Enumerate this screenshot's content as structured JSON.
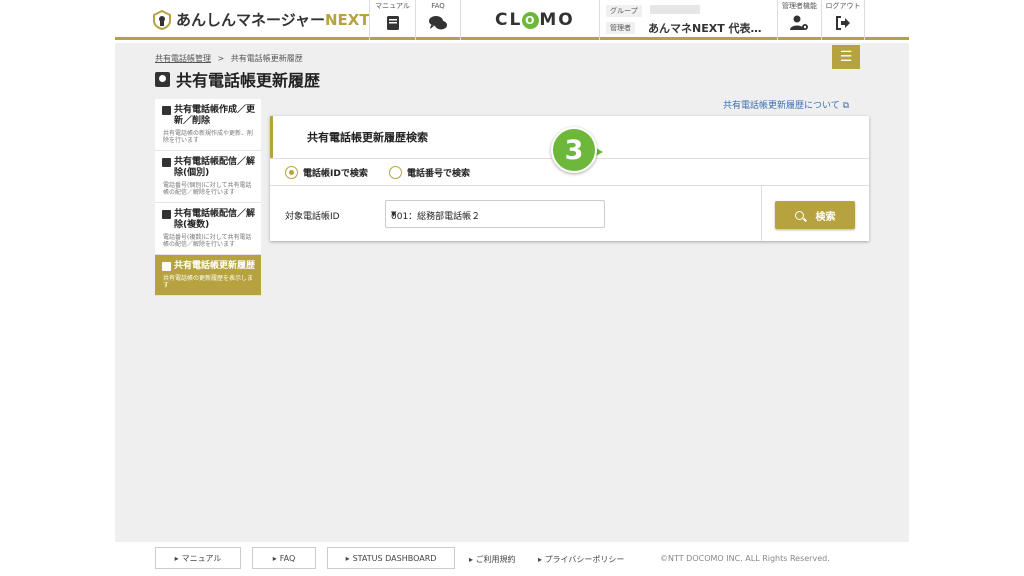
{
  "header": {
    "logo_text": "あんしんマネージャー",
    "logo_accent": "NEXT",
    "manual_caption": "マニュアル",
    "faq_caption": "FAQ",
    "clomo_left": "CL",
    "clomo_o": "O",
    "clomo_right": "MO",
    "group_label": "グループ",
    "admin_label": "管理者",
    "admin_name": "あんマネNEXT 代表…",
    "admin_func_caption": "管理者機能",
    "logout_caption": "ログアウト"
  },
  "breadcrumb": {
    "parent": "共有電話帳管理",
    "separator": ">",
    "current": "共有電話帳更新履歴"
  },
  "page_title": "共有電話帳更新履歴",
  "help_link": "共有電話帳更新履歴について",
  "sidebar": {
    "items": [
      {
        "title": "共有電話帳作成／更新／削除",
        "desc": "共有電話帳の新規作成や更新、削除を行います"
      },
      {
        "title": "共有電話帳配信／解除(個別)",
        "desc": "電話番号(個別)に対して共有電話帳の配信／解除を行います"
      },
      {
        "title": "共有電話帳配信／解除(複数)",
        "desc": "電話番号(複数)に対して共有電話帳の配信／解除を行います"
      },
      {
        "title": "共有電話帳更新履歴",
        "desc": "共有電話帳の更新履歴を表示します"
      }
    ]
  },
  "search_panel": {
    "title": "共有電話帳更新履歴検索",
    "radio_id": "電話帳IDで検索",
    "radio_number": "電話番号で検索",
    "field_label": "対象電話帳ID",
    "select_value": "001：総務部電話帳２",
    "search_button": "検索",
    "step_number": "3"
  },
  "footer": {
    "manual": "マニュアル",
    "faq": "FAQ",
    "status": "STATUS DASHBOARD",
    "terms": "ご利用規約",
    "privacy": "プライバシーポリシー",
    "copyright": "©NTT DOCOMO INC. ALL Rights Reserved."
  },
  "colors": {
    "accent": "#b6a33f",
    "step_badge": "#6db83a",
    "link": "#3a6fb5"
  }
}
